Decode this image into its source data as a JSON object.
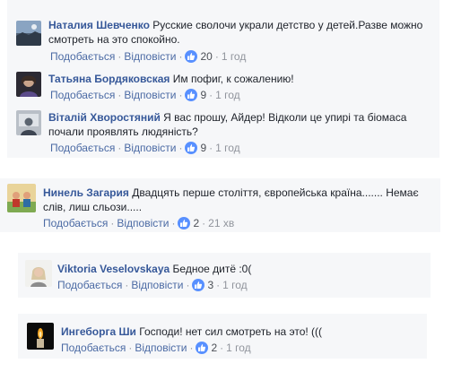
{
  "comments": [
    {
      "author": "Наталия Шевченко",
      "text_line1": "Русские сволочи украли детство у детей.Разве можно",
      "text_line2": "смотреть на это спокойно.",
      "like": "Подобається",
      "reply": "Відповісти",
      "likes": "20",
      "time": "1 год"
    },
    {
      "author": "Татьяна Бордяковская",
      "text_line1": "Им пофиг, к сожалению!",
      "like": "Подобається",
      "reply": "Відповісти",
      "likes": "9",
      "time": "1 год"
    },
    {
      "author": "Віталій Хворостяний",
      "text_line1": "Я вас прошу, Айдер! Відколи це упирі та біомаса",
      "text_line2": "почали проявлять людяність?",
      "like": "Подобається",
      "reply": "Відповісти",
      "likes": "9",
      "time": "1 год"
    },
    {
      "author": "Нинель Загария",
      "text_line1": "Двадцять перше століття, європейська країна....... Немає",
      "text_line2": "слів, лиш сльози.....",
      "like": "Подобається",
      "reply": "Відповісти",
      "likes": "2",
      "time": "21 хв"
    },
    {
      "author": "Viktoria Veselovskaya",
      "text_line1": "Бедное дитё :0(",
      "like": "Подобається",
      "reply": "Відповісти",
      "likes": "3",
      "time": "1 год"
    },
    {
      "author": "Ингеборга Ши",
      "text_line1": "Господи! нет сил смотреть на это! (((",
      "like": "Подобається",
      "reply": "Відповісти",
      "likes": "2",
      "time": "1 год"
    }
  ],
  "colors": {
    "author": "#365899",
    "link": "#4b6aa4",
    "meta": "#90949c",
    "like_badge": "#5890ff",
    "panel": "#f6f7f9"
  },
  "icons": {
    "like_badge": "thumbs-up-icon"
  }
}
